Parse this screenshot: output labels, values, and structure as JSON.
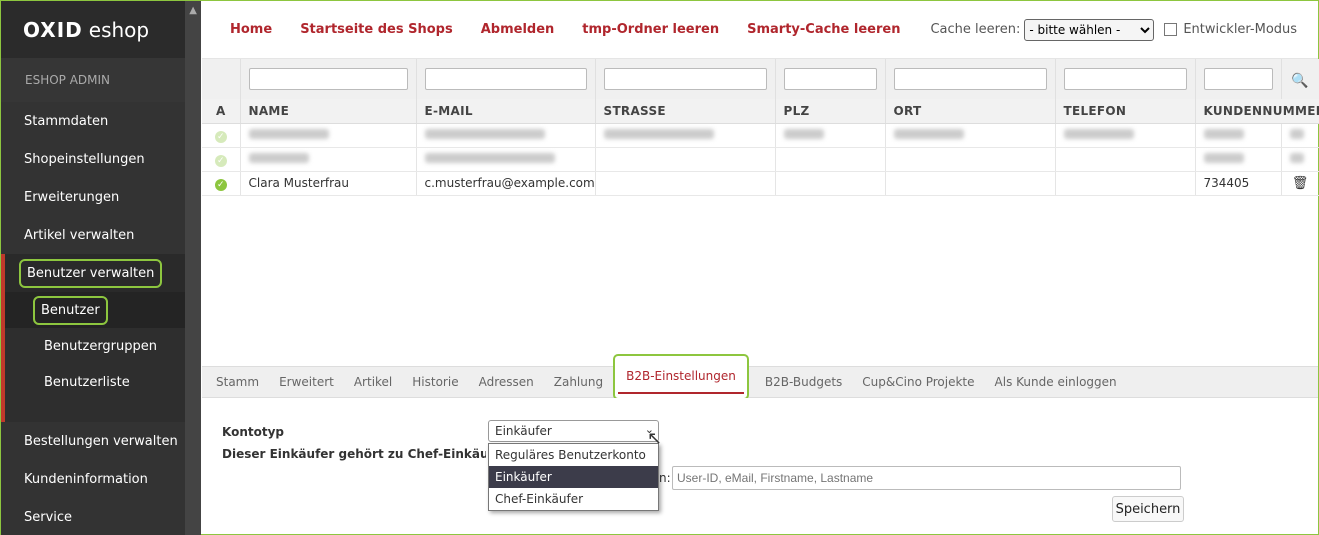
{
  "sidebar": {
    "logo_oxid": "OXID",
    "logo_eshop": "eshop",
    "admin_label": "ESHOP ADMIN",
    "items": [
      {
        "label": "Stammdaten"
      },
      {
        "label": "Shopeinstellungen"
      },
      {
        "label": "Erweiterungen"
      },
      {
        "label": "Artikel verwalten"
      },
      {
        "label": "Benutzer verwalten"
      },
      {
        "label": "Bestellungen verwalten"
      },
      {
        "label": "Kundeninformation"
      },
      {
        "label": "Service"
      }
    ],
    "subitems": [
      {
        "label": "Benutzer"
      },
      {
        "label": "Benutzergruppen"
      },
      {
        "label": "Benutzerliste"
      }
    ]
  },
  "topnav": {
    "links": [
      "Home",
      "Startseite des Shops",
      "Abmelden",
      "tmp-Ordner leeren",
      "Smarty-Cache leeren"
    ],
    "cache_label": "Cache leeren:",
    "cache_select": "- bitte wählen -",
    "devmode_label": "Entwickler-Modus"
  },
  "table": {
    "columns": [
      "A",
      "NAME",
      "E-MAIL",
      "STRASSE",
      "PLZ",
      "ORT",
      "TELEFON",
      "KUNDENNUMMER"
    ],
    "rows": [
      {
        "name": "Clara Musterfrau",
        "email": "c.musterfrau@example.com",
        "street": "",
        "zip": "",
        "city": "",
        "phone": "",
        "number": "734405"
      }
    ]
  },
  "tabs": [
    "Stamm",
    "Erweitert",
    "Artikel",
    "Historie",
    "Adressen",
    "Zahlung",
    "B2B-Einstellungen",
    "B2B-Budgets",
    "Cup&Cino Projekte",
    "Als Kunde einloggen"
  ],
  "form": {
    "kontotyp_label": "Kontotyp",
    "kontotyp_value": "Einkäufer",
    "chef_label": "Dieser Einkäufer gehört zu Chef-Einkäufer:",
    "chef_partial": "n:",
    "chef_placeholder": "User-ID, eMail, Firstname, Lastname",
    "options": [
      "Reguläres Benutzerkonto",
      "Einkäufer",
      "Chef-Einkäufer"
    ],
    "save_label": "Speichern"
  }
}
